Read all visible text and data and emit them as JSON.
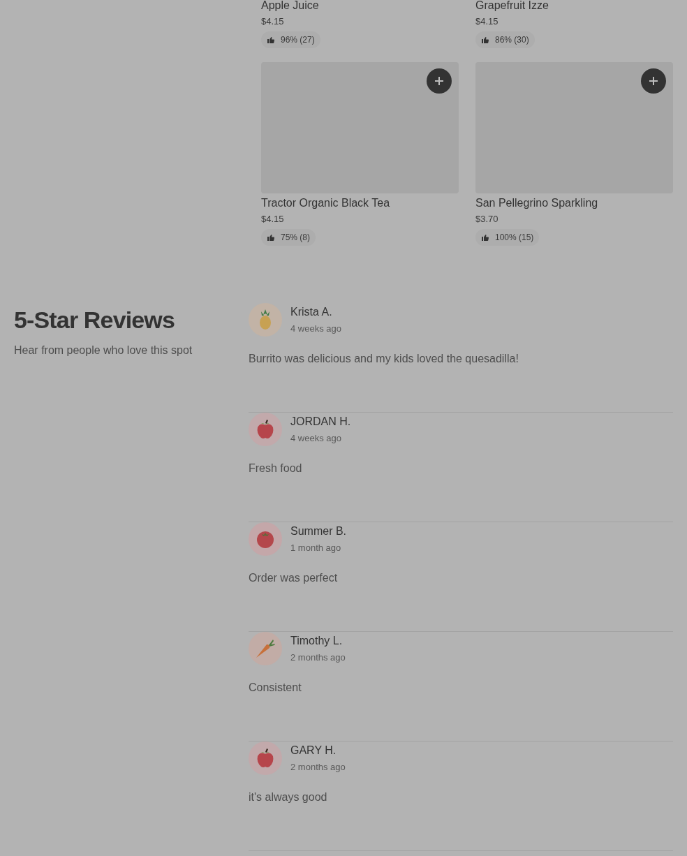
{
  "products": [
    {
      "name": "Apple Juice",
      "price": "$4.15",
      "rating": "96% (27)",
      "has_image": false
    },
    {
      "name": "Grapefruit Izze",
      "price": "$4.15",
      "rating": "86% (30)",
      "has_image": false
    },
    {
      "name": "Tractor Organic Black Tea",
      "price": "$4.15",
      "rating": "75% (8)",
      "has_image": true
    },
    {
      "name": "San Pellegrino Sparkling",
      "price": "$3.70",
      "rating": "100% (15)",
      "has_image": true
    }
  ],
  "reviews_section": {
    "title": "5-Star Reviews",
    "subtitle": "Hear from people who love this spot"
  },
  "reviews": [
    {
      "name": "Krista A.",
      "time": "4 weeks ago",
      "text": "Burrito was delicious and my kids loved the quesadilla!",
      "avatar": {
        "kind": "pineapple",
        "color": "#c2b3a6"
      }
    },
    {
      "name": "JORDAN H.",
      "time": "4 weeks ago",
      "text": "Fresh food",
      "avatar": {
        "kind": "apple",
        "color": "#c2a9ab"
      }
    },
    {
      "name": "Summer B.",
      "time": "1 month ago",
      "text": "Order was perfect",
      "avatar": {
        "kind": "tomato",
        "color": "#c4a7a9"
      }
    },
    {
      "name": "Timothy L.",
      "time": "2 months ago",
      "text": "Consistent",
      "avatar": {
        "kind": "carrot",
        "color": "#c2aca6"
      }
    },
    {
      "name": "GARY H.",
      "time": "2 months ago",
      "text": "it's always good",
      "avatar": {
        "kind": "apple",
        "color": "#c2a9ab"
      }
    }
  ]
}
